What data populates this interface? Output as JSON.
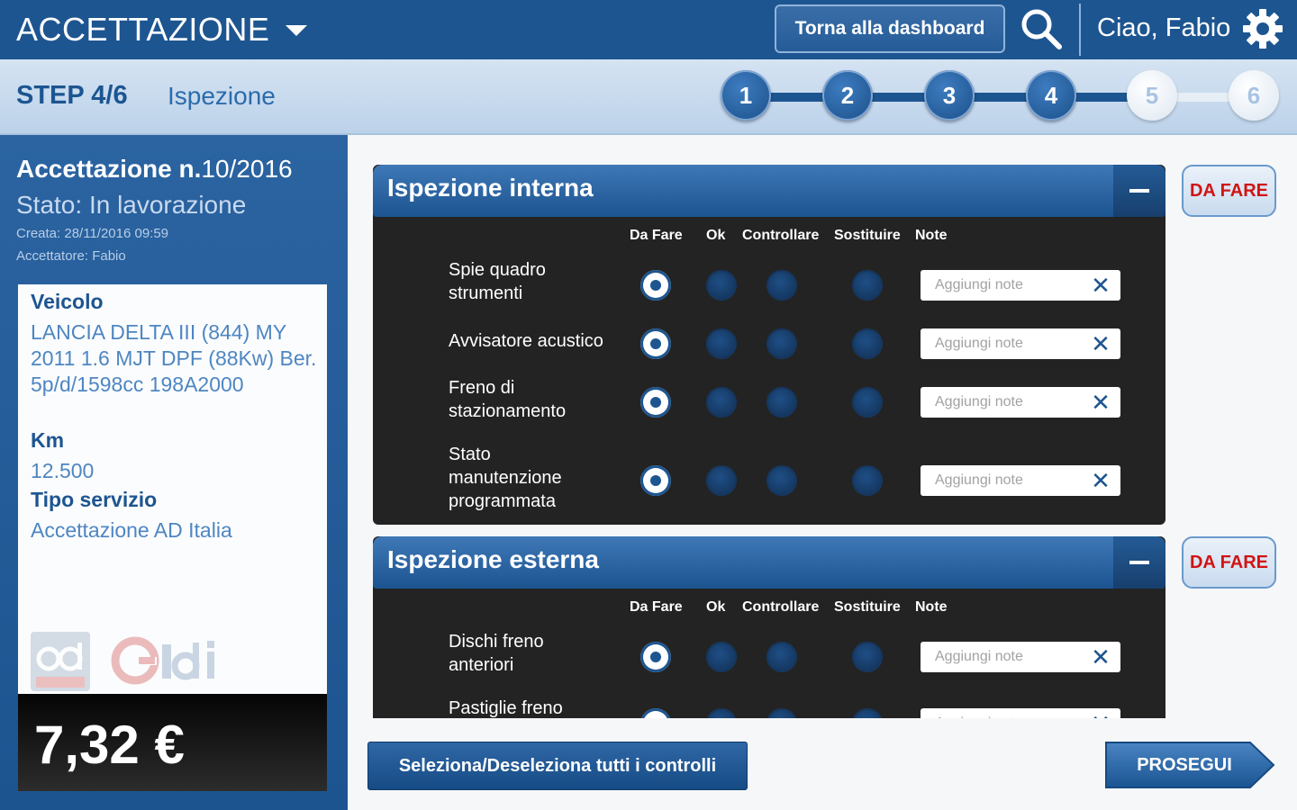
{
  "header": {
    "title": "ACCETTAZIONE",
    "dashboard_button": "Torna alla dashboard",
    "greeting": "Ciao, Fabio"
  },
  "stepbar": {
    "step_label": "STEP 4/6",
    "step_name": "Ispezione",
    "steps": [
      {
        "label": "1",
        "status": "done"
      },
      {
        "label": "2",
        "status": "done"
      },
      {
        "label": "3",
        "status": "done"
      },
      {
        "label": "4",
        "status": "done"
      },
      {
        "label": "5",
        "status": "todo"
      },
      {
        "label": "6",
        "status": "todo"
      }
    ]
  },
  "sidebar": {
    "title_prefix": "Accettazione n.",
    "title_number": "10/2016",
    "state": "Stato: In lavorazione",
    "created": "Creata: 28/11/2016 09:59",
    "operator": "Accettatore: Fabio",
    "vehicle_label": "Veicolo",
    "vehicle_value": "LANCIA DELTA III (844) MY 2011 1.6 MJT DPF (88Kw) Ber. 5p/d/1598cc 198A2000",
    "km_label": "Km",
    "km_value": "12.500",
    "service_label": "Tipo servizio",
    "service_value": "Accettazione AD Italia",
    "price": "7,32 €"
  },
  "columns": {
    "da_fare": "Da Fare",
    "ok": "Ok",
    "controllare": "Controllare",
    "sostituire": "Sostituire",
    "note": "Note"
  },
  "note_placeholder": "Aggiungi note",
  "sections": {
    "interna": {
      "title": "Ispezione interna",
      "badge": "DA FARE",
      "rows": [
        {
          "label": "Spie quadro strumenti",
          "selected": "da_fare"
        },
        {
          "label": "Avvisatore acustico",
          "selected": "da_fare"
        },
        {
          "label": "Freno di stazionamento",
          "selected": "da_fare"
        },
        {
          "label": "Stato manutenzione programmata",
          "selected": "da_fare"
        }
      ]
    },
    "esterna": {
      "title": "Ispezione esterna",
      "badge": "DA FARE",
      "rows": [
        {
          "label": "Dischi freno anteriori",
          "selected": "da_fare"
        },
        {
          "label": "Pastiglie freno",
          "selected": "da_fare"
        }
      ]
    }
  },
  "footer": {
    "select_all": "Seleziona/Deseleziona tutti i controlli",
    "proceed": "PROSEGUI"
  },
  "colors": {
    "primary": "#1d5590",
    "panel_bg": "#232323",
    "badge_text": "#d01414"
  },
  "icons": [
    "chevron-down-icon",
    "search-icon",
    "gear-icon",
    "minus-icon",
    "close-icon"
  ]
}
